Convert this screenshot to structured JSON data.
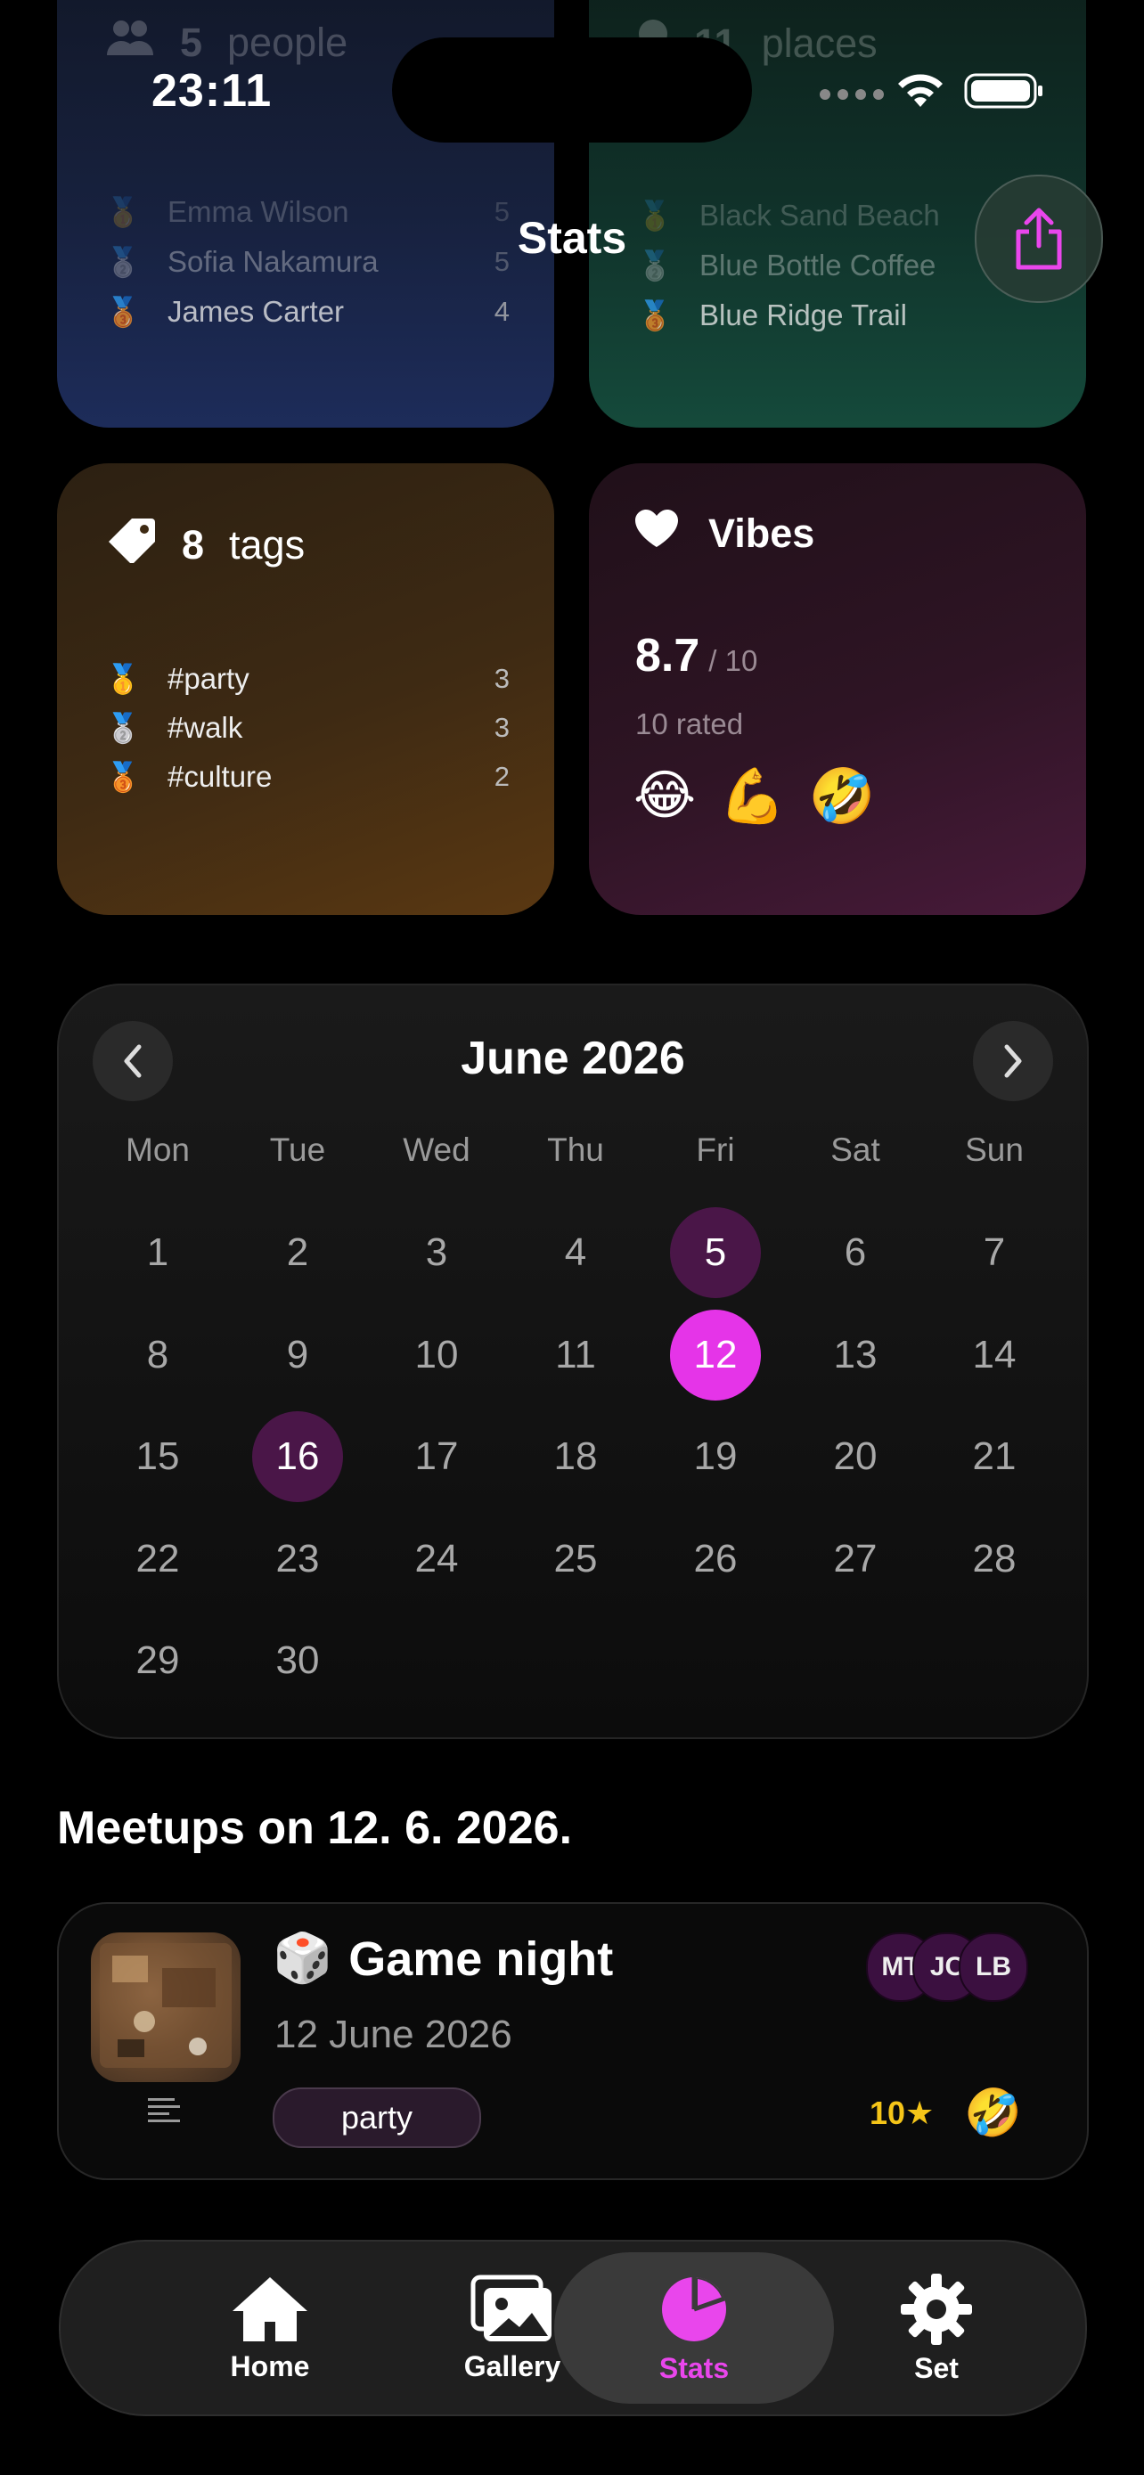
{
  "status_bar": {
    "time": "23:11"
  },
  "header": {
    "title": "Stats"
  },
  "people_card": {
    "count": "5",
    "label": "people",
    "ranks": [
      {
        "medal": "🥇",
        "name": "Emma Wilson",
        "count": "5"
      },
      {
        "medal": "🥈",
        "name": "Sofia Nakamura",
        "count": "5"
      },
      {
        "medal": "🥉",
        "name": "James Carter",
        "count": "4"
      }
    ]
  },
  "places_card": {
    "count": "11",
    "label": "places",
    "ranks": [
      {
        "medal": "🥇",
        "name": "Black Sand Beach"
      },
      {
        "medal": "🥈",
        "name": "Blue Bottle Coffee"
      },
      {
        "medal": "🥉",
        "name": "Blue Ridge Trail"
      }
    ]
  },
  "tags_card": {
    "count": "8",
    "label": "tags",
    "ranks": [
      {
        "medal": "🥇",
        "name": "#party",
        "count": "3"
      },
      {
        "medal": "🥈",
        "name": "#walk",
        "count": "3"
      },
      {
        "medal": "🥉",
        "name": "#culture",
        "count": "2"
      }
    ]
  },
  "vibes_card": {
    "title": "Vibes",
    "score": "8.7",
    "score_max": "/ 10",
    "rated": "10 rated",
    "emojis": [
      "😂",
      "💪",
      "🤣"
    ]
  },
  "calendar": {
    "title": "June 2026",
    "weekdays": [
      "Mon",
      "Tue",
      "Wed",
      "Thu",
      "Fri",
      "Sat",
      "Sun"
    ],
    "first_weekday_index": 0,
    "days_in_month": 30,
    "marked_days": [
      5,
      16
    ],
    "selected_day": 12
  },
  "meetups": {
    "section_title": "Meetups on 12. 6. 2026.",
    "items": [
      {
        "emoji": "🎲",
        "title": "Game night",
        "date": "12 June 2026",
        "tag": "party",
        "rating": "10★",
        "vibe": "🤣",
        "avatars": [
          "MT",
          "JC",
          "LB"
        ]
      }
    ]
  },
  "tabbar": {
    "tabs": [
      {
        "label": "Home",
        "icon": "house-icon"
      },
      {
        "label": "Gallery",
        "icon": "photos-icon"
      },
      {
        "label": "Stats",
        "icon": "pie-chart-icon",
        "active": true
      },
      {
        "label": "Set",
        "icon": "gear-icon"
      }
    ]
  },
  "colors": {
    "accent": "#e946ec",
    "marked_day": "#4a1648",
    "rating": "#f5c518"
  }
}
